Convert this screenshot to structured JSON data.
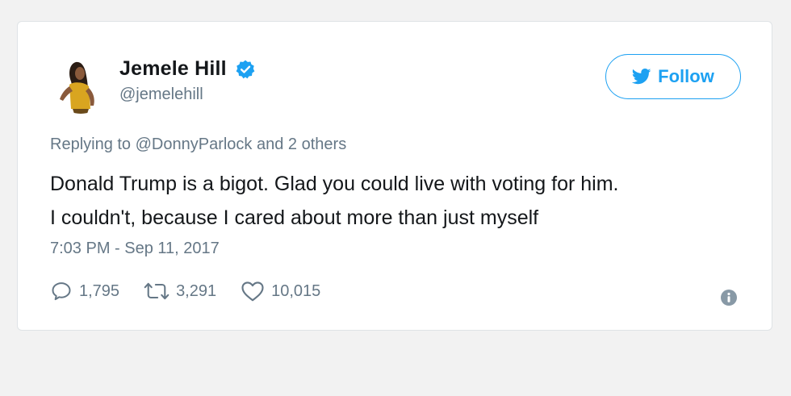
{
  "tweet": {
    "display_name": "Jemele Hill",
    "handle": "@jemelehill",
    "verified": true,
    "follow_label": "Follow",
    "reply_prefix": "Replying to",
    "reply_mention": "@DonnyParlock",
    "reply_suffix": "and 2 others",
    "text_line1": "Donald Trump is a bigot. Glad you could live with voting for him.",
    "text_line2": "I couldn't, because I cared about more than just myself",
    "timestamp": "7:03 PM - Sep 11, 2017",
    "replies": "1,795",
    "retweets": "3,291",
    "likes": "10,015"
  },
  "icons": {
    "verified": "verified-badge-icon",
    "follow": "twitter-bird-icon",
    "reply": "reply-icon",
    "retweet": "retweet-icon",
    "like": "heart-icon",
    "info": "info-icon"
  },
  "colors": {
    "accent": "#1da1f2",
    "secondary_text": "#657786",
    "primary_text": "#14171a"
  }
}
